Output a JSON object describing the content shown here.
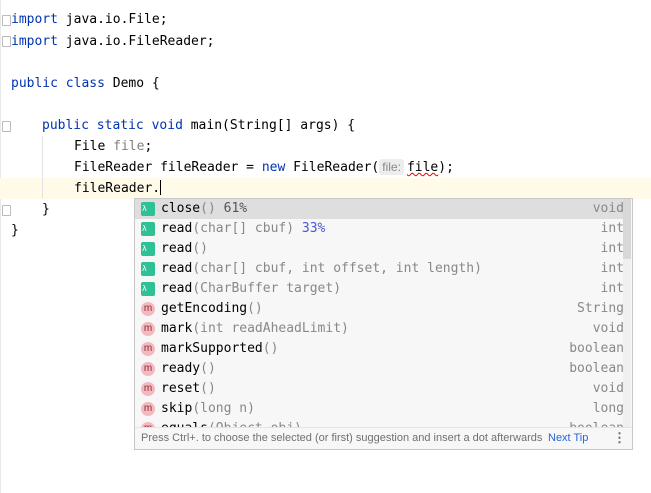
{
  "editor": {
    "lines": {
      "l1": {
        "kw": "import",
        "rest": " java.io.File;"
      },
      "l2": {
        "kw": "import",
        "rest": " java.io.FileReader;"
      },
      "l4": {
        "kw1": "public",
        "kw2": "class",
        "rest": " Demo {"
      },
      "l6": {
        "kw1": "public",
        "kw2": "static",
        "kw3": "void",
        "rest": " main(String[] args) {"
      },
      "l7": {
        "type": "File ",
        "var": "file",
        "end": ";"
      },
      "l8": {
        "pre": "FileReader fileReader = ",
        "kw": "new",
        "call": " FileReader(",
        "hint": "file:",
        "arg": "file",
        "end": ");"
      },
      "l9": {
        "text": "fileReader."
      },
      "l10": {
        "text": "}"
      },
      "l11": {
        "text": "}"
      }
    }
  },
  "completion": {
    "items": [
      {
        "icon": "lambda",
        "name": "close",
        "params": "()",
        "pct": " 61%",
        "type": "void"
      },
      {
        "icon": "lambda",
        "name": "read",
        "params": "(char[] cbuf)",
        "pct": " 33%",
        "type": "int"
      },
      {
        "icon": "lambda",
        "name": "read",
        "params": "()",
        "pct": "",
        "type": "int"
      },
      {
        "icon": "lambda",
        "name": "read",
        "params": "(char[] cbuf, int offset, int length)",
        "pct": "",
        "type": "int"
      },
      {
        "icon": "lambda",
        "name": "read",
        "params": "(CharBuffer target)",
        "pct": "",
        "type": "int"
      },
      {
        "icon": "m",
        "name": "getEncoding",
        "params": "()",
        "pct": "",
        "type": "String"
      },
      {
        "icon": "m",
        "name": "mark",
        "params": "(int readAheadLimit)",
        "pct": "",
        "type": "void"
      },
      {
        "icon": "m",
        "name": "markSupported",
        "params": "()",
        "pct": "",
        "type": "boolean"
      },
      {
        "icon": "m",
        "name": "ready",
        "params": "()",
        "pct": "",
        "type": "boolean"
      },
      {
        "icon": "m",
        "name": "reset",
        "params": "()",
        "pct": "",
        "type": "void"
      },
      {
        "icon": "m",
        "name": "skip",
        "params": "(long n)",
        "pct": "",
        "type": "long"
      },
      {
        "icon": "m",
        "name": "equals",
        "params": "(Object obj)",
        "pct": "",
        "type": "boolean"
      }
    ],
    "method_icon_letter": "m",
    "lambda_icon_glyph": "λ",
    "footer_tip": "Press Ctrl+. to choose the selected (or first) suggestion and insert a dot afterwards",
    "next_tip": "Next Tip",
    "more_glyph": "⋮",
    "colors": {
      "lambda": "#2ec196",
      "method": "#f4b8bf",
      "link": "#2466d8",
      "keyword": "#0033b3"
    }
  }
}
